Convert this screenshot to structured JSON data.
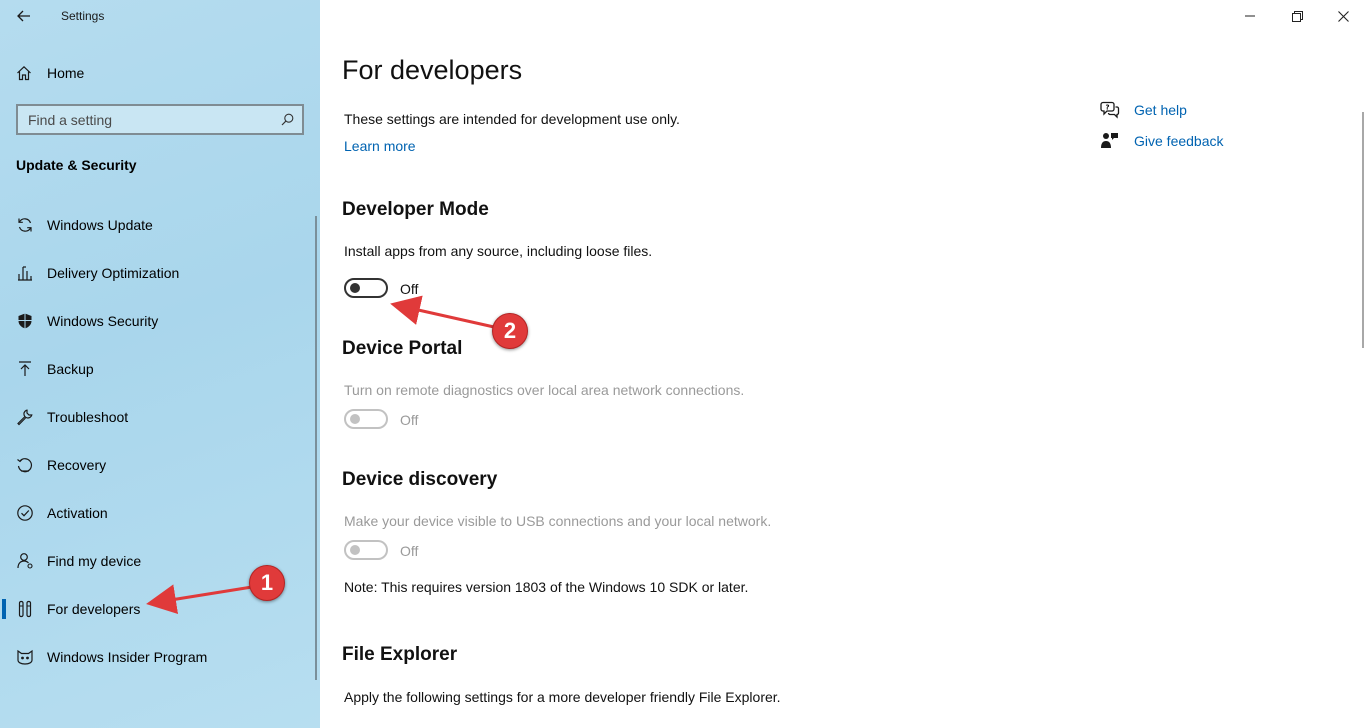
{
  "window": {
    "title": "Settings",
    "controls": [
      "minimize-icon",
      "restore-icon",
      "close-icon"
    ]
  },
  "sidebar": {
    "home_label": "Home",
    "search_placeholder": "Find a setting",
    "section_title": "Update & Security",
    "items": [
      {
        "label": "Windows Update",
        "icon": "sync-icon"
      },
      {
        "label": "Delivery Optimization",
        "icon": "delivery-icon"
      },
      {
        "label": "Windows Security",
        "icon": "shield-icon"
      },
      {
        "label": "Backup",
        "icon": "upload-icon"
      },
      {
        "label": "Troubleshoot",
        "icon": "wrench-icon"
      },
      {
        "label": "Recovery",
        "icon": "recovery-icon"
      },
      {
        "label": "Activation",
        "icon": "check-circle-icon"
      },
      {
        "label": "Find my device",
        "icon": "person-location-icon"
      },
      {
        "label": "For developers",
        "icon": "developer-tools-icon",
        "selected": true
      },
      {
        "label": "Windows Insider Program",
        "icon": "insider-cat-icon"
      }
    ]
  },
  "main": {
    "title": "For developers",
    "intro": "These settings are intended for development use only.",
    "learn_more": "Learn more",
    "help": {
      "get_help": "Get help",
      "give_feedback": "Give feedback"
    },
    "developer_mode": {
      "heading": "Developer Mode",
      "description": "Install apps from any source, including loose files.",
      "state": "Off"
    },
    "device_portal": {
      "heading": "Device Portal",
      "description": "Turn on remote diagnostics over local area network connections.",
      "state": "Off"
    },
    "device_discovery": {
      "heading": "Device discovery",
      "description": "Make your device visible to USB connections and your local network.",
      "state": "Off",
      "note": "Note: This requires version 1803 of the Windows 10 SDK or later."
    },
    "file_explorer": {
      "heading": "File Explorer",
      "description": "Apply the following settings for a more developer friendly File Explorer."
    }
  },
  "annotations": {
    "badge_1": "1",
    "badge_2": "2",
    "color": "#e03a3a"
  },
  "colors": {
    "accent": "#0063b1",
    "sidebar_bg": "#b5dcef"
  }
}
